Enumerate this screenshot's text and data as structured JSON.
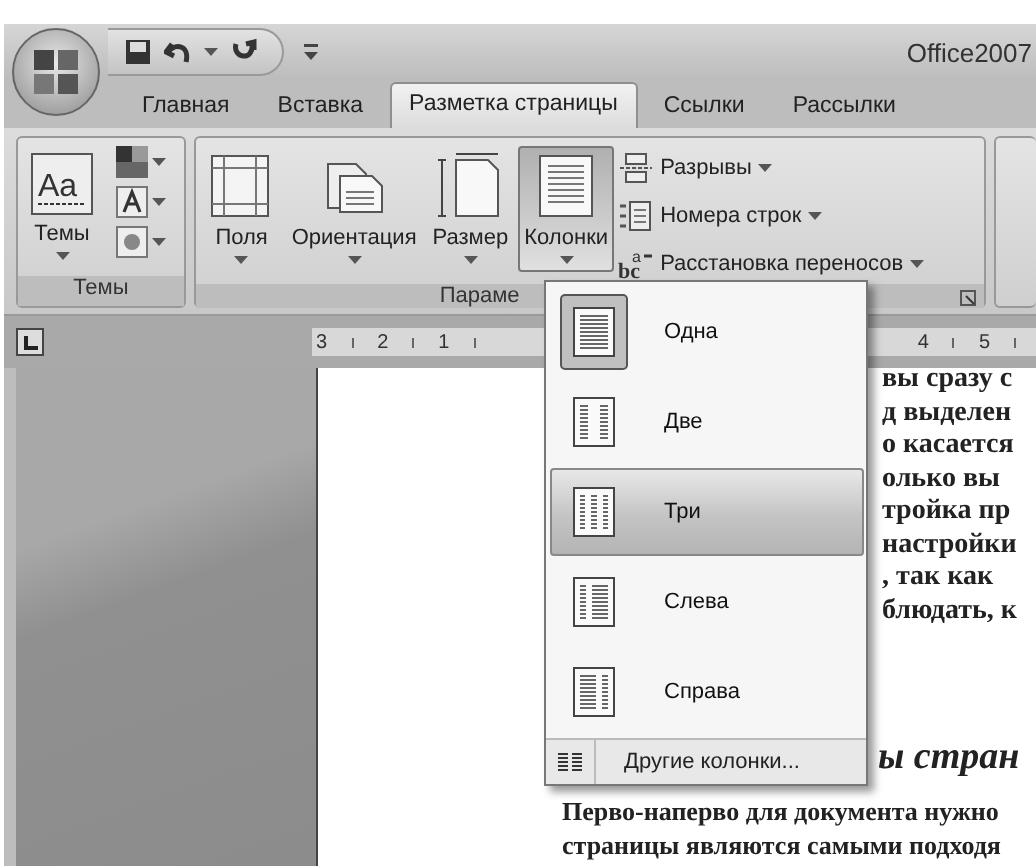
{
  "window": {
    "title": "Office2007"
  },
  "tabs": [
    {
      "label": "Главная",
      "selected": false
    },
    {
      "label": "Вставка",
      "selected": false
    },
    {
      "label": "Разметка страницы",
      "selected": true
    },
    {
      "label": "Ссылки",
      "selected": false
    },
    {
      "label": "Рассылки",
      "selected": false
    }
  ],
  "themes_group": {
    "label": "Темы",
    "button": "Темы",
    "icon_text": "Aa"
  },
  "page_setup_group": {
    "label": "Параме",
    "large_buttons": [
      {
        "label": "Поля",
        "kind": "margins",
        "pressed": false
      },
      {
        "label": "Ориентация",
        "kind": "orientation",
        "pressed": false
      },
      {
        "label": "Размер",
        "kind": "size",
        "pressed": false
      },
      {
        "label": "Колонки",
        "kind": "columns",
        "pressed": true
      }
    ],
    "small_buttons": [
      {
        "label": "Разрывы",
        "kind": "breaks"
      },
      {
        "label": "Номера строк",
        "kind": "line-numbers"
      },
      {
        "label": "Расстановка переносов",
        "kind": "hyphenation",
        "icon_text": [
          "a",
          "bc"
        ]
      }
    ]
  },
  "ruler": {
    "left_numbers": [
      "3",
      "2",
      "1"
    ],
    "right_numbers": [
      "4",
      "5"
    ]
  },
  "columns_menu": {
    "items": [
      {
        "label": "Одна",
        "kind": "one",
        "checked": true,
        "selected": false
      },
      {
        "label": "Две",
        "kind": "two",
        "checked": false,
        "selected": false
      },
      {
        "label": "Три",
        "kind": "three",
        "checked": false,
        "selected": true
      },
      {
        "label": "Слева",
        "kind": "left",
        "checked": false,
        "selected": false
      },
      {
        "label": "Справа",
        "kind": "right",
        "checked": false,
        "selected": false
      }
    ],
    "footer": "Другие колонки..."
  },
  "document": {
    "partial_lines": [
      "вы сразу с",
      "д выделен",
      "о касается",
      "олько вы",
      "тройка пр",
      "настройки",
      ", так как",
      "блюдать, к"
    ],
    "heading": "ы стран",
    "lines": [
      "Перво-наперво для документа нужно",
      "страницы являются самыми подходя"
    ]
  }
}
